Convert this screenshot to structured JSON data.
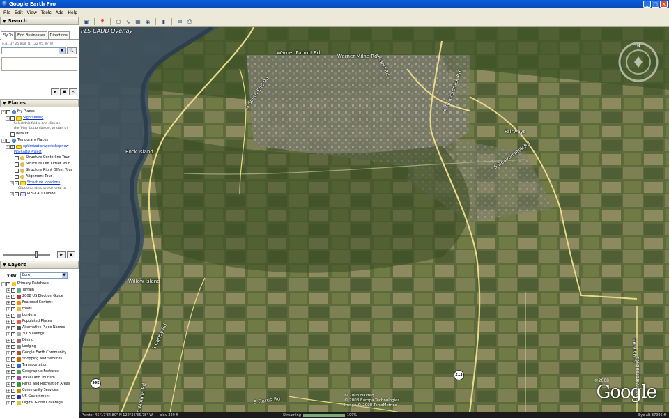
{
  "window": {
    "title": "Google Earth Pro"
  },
  "menu": [
    "File",
    "Edit",
    "View",
    "Tools",
    "Add",
    "Help"
  ],
  "toolbar": {
    "icons": [
      "sidebar-icon",
      "placemark-icon",
      "polygon-icon",
      "path-icon",
      "overlay-icon",
      "tour-icon",
      "historical-imagery-icon",
      "sun-icon",
      "planets-icon",
      "ruler-icon",
      "email-icon",
      "print-icon",
      "maps-icon"
    ]
  },
  "search": {
    "header": "Search",
    "tabs": [
      "Fly To",
      "Find Businesses",
      "Directions"
    ],
    "hint": "e.g., 37 25.818' N, 122 05.36' W",
    "value": ""
  },
  "places": {
    "header": "Places",
    "items": [
      {
        "label": "My Places",
        "level": 0,
        "icon": "globe",
        "expand": "-",
        "check": ""
      },
      {
        "label": "Sightseeing",
        "level": 1,
        "icon": "folder",
        "expand": "+",
        "check": "",
        "link": true
      },
      {
        "label": "Select this folder and click on",
        "level": 3,
        "sub": true
      },
      {
        "label": "the 'Play' button below, to start th",
        "level": 3,
        "sub": true
      },
      {
        "label": "default",
        "level": 1,
        "icon": "",
        "expand": "",
        "check": ""
      },
      {
        "label": "Temporary Places",
        "level": 0,
        "icon": "globe",
        "expand": "-",
        "check": ""
      },
      {
        "label": "optimizationworkshopnew",
        "level": 1,
        "icon": "folder",
        "expand": "-",
        "check": "✓",
        "link": true
      },
      {
        "label": "PLS-CADD Project",
        "level": 3,
        "sub": true,
        "link": true
      },
      {
        "label": "Structure Centerline Tour",
        "level": 2,
        "icon": "tour",
        "expand": "",
        "check": ""
      },
      {
        "label": "Structure Left Offset Tour",
        "level": 2,
        "icon": "tour",
        "expand": "",
        "check": ""
      },
      {
        "label": "Structure Right Offset Tour",
        "level": 2,
        "icon": "tour",
        "expand": "",
        "check": ""
      },
      {
        "label": "Alignment Tour",
        "level": 2,
        "icon": "tour",
        "expand": "",
        "check": ""
      },
      {
        "label": "Structure locations",
        "level": 2,
        "icon": "folder",
        "expand": "+",
        "check": "✓",
        "link": true
      },
      {
        "label": "Click on a structure to jump to",
        "level": 4,
        "sub": true
      },
      {
        "label": "PLS-CADD Model",
        "level": 2,
        "icon": "doc",
        "expand": "+",
        "check": "✓"
      }
    ]
  },
  "layers": {
    "header": "Layers",
    "view_label": "View:",
    "view_value": "Core",
    "items": [
      {
        "label": "Primary Database",
        "top": true,
        "color": "#f4c430"
      },
      {
        "label": "Terrain",
        "color": "#6a8"
      },
      {
        "label": "2008 US Election Guide",
        "color": "#c33"
      },
      {
        "label": "Featured Content",
        "color": "#f80"
      },
      {
        "label": "roads",
        "color": "#eb3"
      },
      {
        "label": "borders",
        "color": "#999"
      },
      {
        "label": "Populated Places",
        "color": "#e54"
      },
      {
        "label": "Alternative Place Names",
        "color": "#555"
      },
      {
        "label": "3D Buildings",
        "color": "#aaa"
      },
      {
        "label": "Dining",
        "color": "#a66"
      },
      {
        "label": "Lodging",
        "color": "#888"
      },
      {
        "label": "Google Earth Community",
        "color": "#a52"
      },
      {
        "label": "Shopping and Services",
        "color": "#c60"
      },
      {
        "label": "Transportation",
        "color": "#36c"
      },
      {
        "label": "Geographic Features",
        "color": "#4a4"
      },
      {
        "label": "Travel and Tourism",
        "color": "#a4a"
      },
      {
        "label": "Parks and Recreation Areas",
        "color": "#393"
      },
      {
        "label": "Community Services",
        "color": "#c80"
      },
      {
        "label": "US Government",
        "color": "#33a"
      },
      {
        "label": "Digital Globe Coverage",
        "color": "#cc3"
      }
    ]
  },
  "map": {
    "overlay_title": "PLS-CADD Overlay",
    "labels": {
      "warner_parrott": "Warner Parrott Rd",
      "warner_milne": "Warner Milne Rd",
      "south_end": "S South End Rd",
      "leland": "Leland Rd",
      "beaver_creek": "S Beavercreek Rd",
      "beaver_creek2": "S Beavercreek Rd",
      "fairways": "Fairways",
      "rock_island": "Rock Island",
      "willow_island": "Willow Island",
      "canby": "S Canby Rd",
      "carus": "S Carus Rd",
      "molalla": "S Molalla Rd",
      "main": "S Main Rd",
      "hwy99e": "99E",
      "hwy213": "213"
    },
    "credits": [
      "© 2008 Navteq",
      "© 2008 Europa Technologies",
      "Image © 2008 TerraMetrics"
    ],
    "logo_year": "©2008",
    "logo": "Google"
  },
  "status": {
    "pointer": "Pointer  45°17'34.80\" N  122°36'35.78\" W",
    "elev": "elev  329 ft",
    "streaming": "Streaming",
    "streaming_pct": "100%",
    "stream_fraction": 1.0,
    "eye_alt": "Eye alt  37995 ft"
  }
}
